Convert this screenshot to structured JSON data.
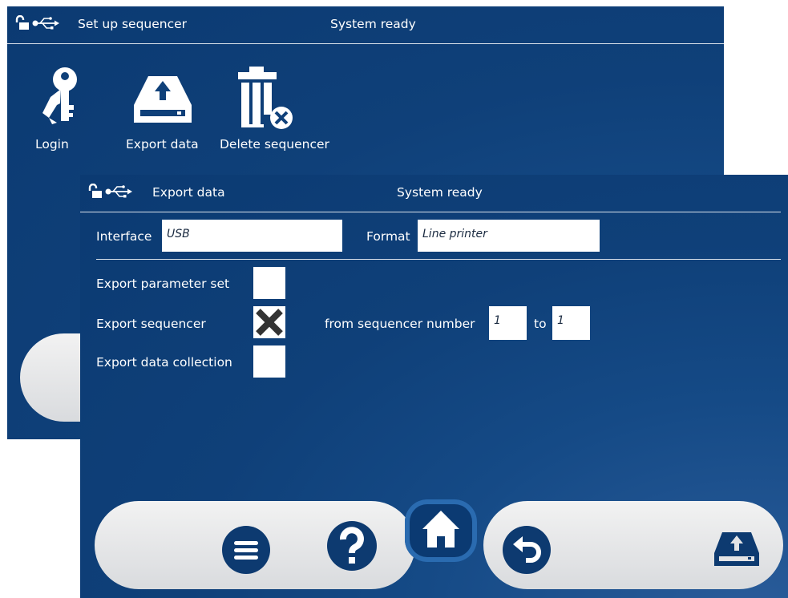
{
  "back_screen": {
    "title": "Set up sequencer",
    "status": "System ready",
    "tiles": [
      {
        "label": "Login",
        "icon": "keys-icon"
      },
      {
        "label": "Export data",
        "icon": "export-drive-icon"
      },
      {
        "label": "Delete sequencer",
        "icon": "trash-delete-icon"
      }
    ]
  },
  "front_screen": {
    "title": "Export data",
    "status": "System ready",
    "interface": {
      "label": "Interface",
      "value": "USB"
    },
    "format": {
      "label": "Format",
      "value": "Line printer"
    },
    "options": [
      {
        "label": "Export parameter set",
        "checked": false
      },
      {
        "label": "Export sequencer",
        "checked": true
      },
      {
        "label": "Export data collection",
        "checked": false
      }
    ],
    "range": {
      "from_label": "from sequencer number",
      "from_value": "1",
      "to_label": "to",
      "to_value": "1"
    }
  },
  "toolbar": {
    "buttons": [
      "menu-icon",
      "help-icon",
      "home-icon",
      "undo-icon",
      "export-drive-icon"
    ]
  },
  "colors": {
    "background": "#0f4079",
    "field": "#ffffff",
    "button": "#0d3a70",
    "pill": "#e3e4e6"
  }
}
